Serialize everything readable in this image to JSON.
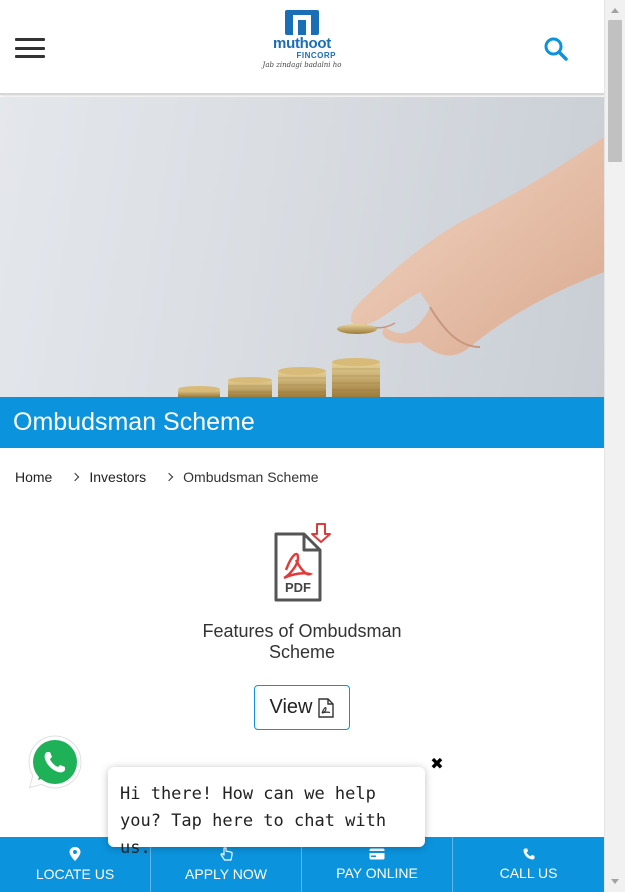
{
  "header": {
    "menu_icon": "hamburger-menu-icon",
    "logo": {
      "name": "muthoot",
      "sub": "FINCORP",
      "tagline": "Jab zindagi badalni ho"
    },
    "search_icon": "search-icon"
  },
  "hero": {
    "image": "hand-placing-coin-on-stacks"
  },
  "page_title": "Ombudsman Scheme",
  "breadcrumb": [
    {
      "label": "Home"
    },
    {
      "label": "Investors"
    },
    {
      "label": "Ombudsman Scheme"
    }
  ],
  "document": {
    "icon": "pdf-download-icon",
    "title": "Features of Ombudsman Scheme",
    "view_label": "View"
  },
  "whatsapp": {
    "icon": "whatsapp-icon"
  },
  "chat": {
    "message": "Hi there! How can we help you? Tap here to chat with us.",
    "close_icon": "close-icon"
  },
  "bottom_nav": [
    {
      "label": "LOCATE US",
      "icon": "location-pin-icon"
    },
    {
      "label": "APPLY NOW",
      "icon": "hand-pointer-icon"
    },
    {
      "label": "PAY ONLINE",
      "icon": "card-icon"
    },
    {
      "label": "CALL US",
      "icon": "phone-icon"
    }
  ],
  "colors": {
    "brand_blue": "#0b93dd",
    "logo_blue": "#1a6eb6",
    "pdf_red": "#e03a3a"
  }
}
